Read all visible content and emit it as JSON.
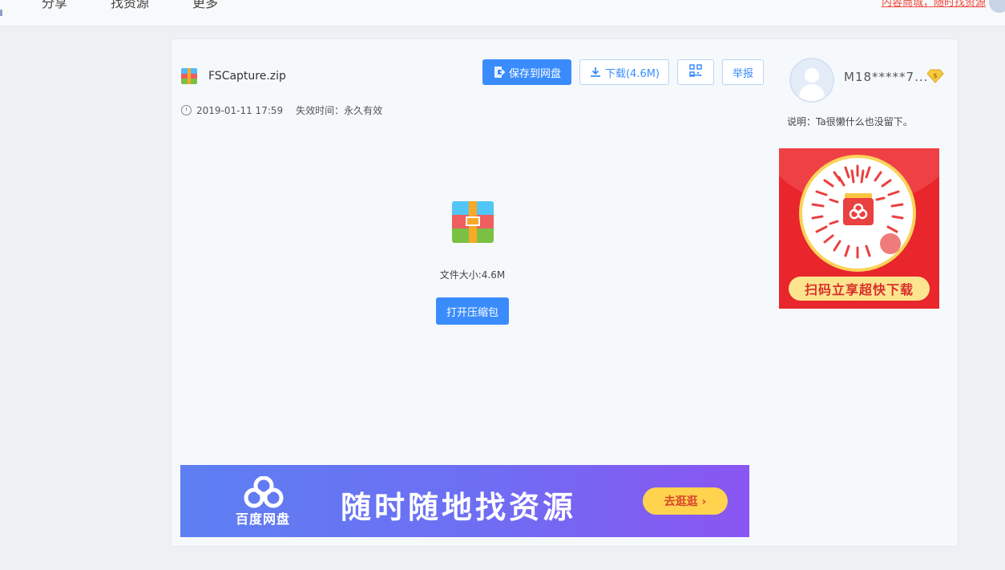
{
  "topnav": {
    "items": [
      "分享",
      "找资源",
      "更多"
    ],
    "mall_link": "内容商城，随时找资源"
  },
  "file": {
    "name": "FSCapture.zip",
    "date": "2019-01-11 17:59",
    "expire_label": "失效时间：永久有效",
    "size_text": "文件大小:4.6M"
  },
  "actions": {
    "save_label": "保存到网盘",
    "download_label": "下载(4.6M)",
    "report_label": "举报",
    "open_label": "打开压缩包"
  },
  "user": {
    "name": "M18*****7...",
    "description": "说明：Ta很懒什么也没留下。",
    "badge": "$"
  },
  "banner": {
    "logo_text": "百度网盘",
    "slogan": "随时随地找资源",
    "cta": "去逛逛 ›"
  },
  "qr_ad": {
    "caption": "扫码立享超快下载"
  },
  "colors": {
    "primary": "#3a8cfc",
    "ad_red": "#e8262b",
    "banner_start": "#5d7ff2",
    "banner_end": "#8a55f2"
  }
}
